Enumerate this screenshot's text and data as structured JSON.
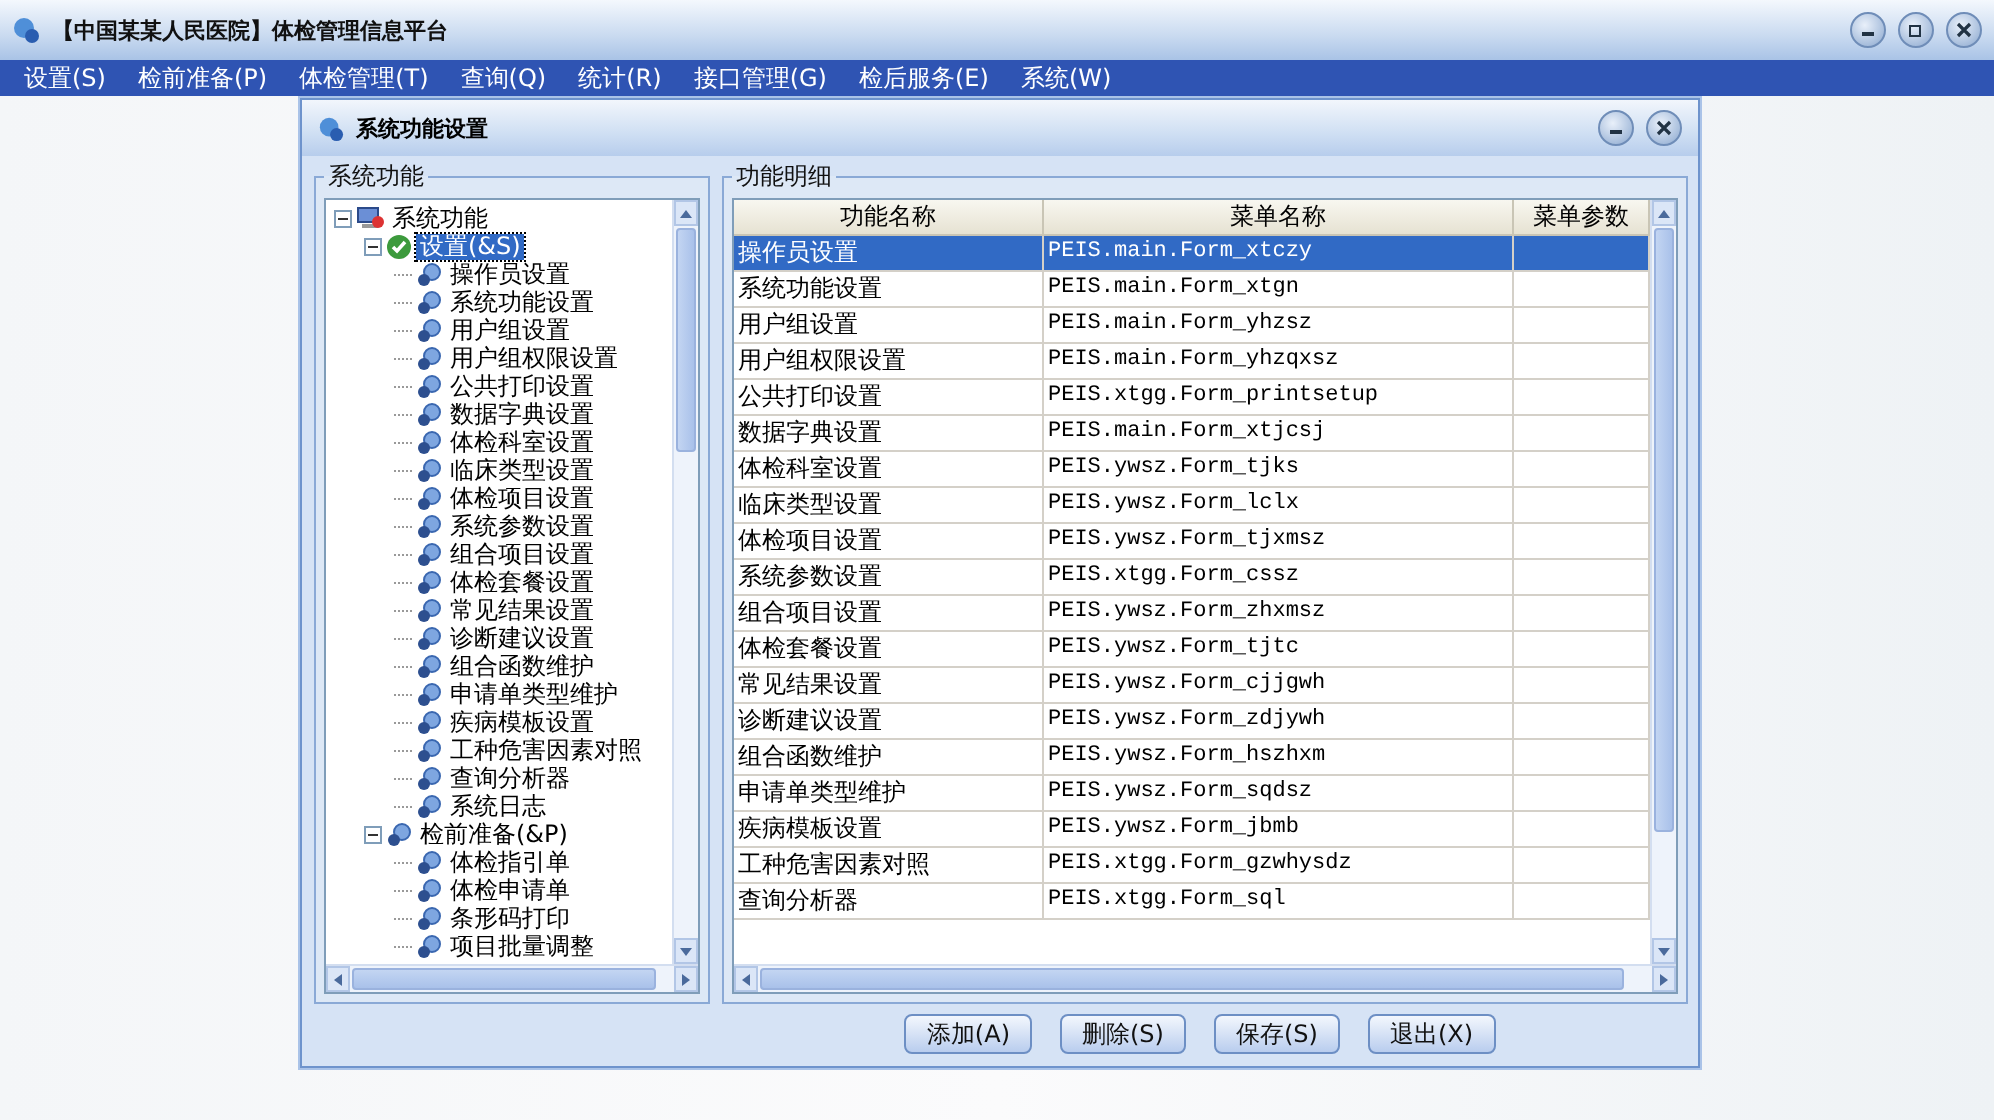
{
  "window": {
    "title": "【中国某某人民医院】体检管理信息平台"
  },
  "menu": [
    {
      "label": "设置(S)"
    },
    {
      "label": "检前准备(P)"
    },
    {
      "label": "体检管理(T)"
    },
    {
      "label": "查询(Q)"
    },
    {
      "label": "统计(R)"
    },
    {
      "label": "接口管理(G)"
    },
    {
      "label": "检后服务(E)"
    },
    {
      "label": "系统(W)"
    }
  ],
  "dialog": {
    "title": "系统功能设置",
    "tree_group": {
      "title": "系统功能",
      "tree": [
        {
          "label": "系统功能",
          "expanded": true,
          "selected": false,
          "children": [
            {
              "label": "设置(&S)",
              "expanded": true,
              "selected": true,
              "children": [
                {
                  "label": "操作员设置",
                  "selected": false
                },
                {
                  "label": "系统功能设置",
                  "selected": false
                },
                {
                  "label": "用户组设置",
                  "selected": false
                },
                {
                  "label": "用户组权限设置",
                  "selected": false
                },
                {
                  "label": "公共打印设置",
                  "selected": false
                },
                {
                  "label": "数据字典设置",
                  "selected": false
                },
                {
                  "label": "体检科室设置",
                  "selected": false
                },
                {
                  "label": "临床类型设置",
                  "selected": false
                },
                {
                  "label": "体检项目设置",
                  "selected": false
                },
                {
                  "label": "系统参数设置",
                  "selected": false
                },
                {
                  "label": "组合项目设置",
                  "selected": false
                },
                {
                  "label": "体检套餐设置",
                  "selected": false
                },
                {
                  "label": "常见结果设置",
                  "selected": false
                },
                {
                  "label": "诊断建议设置",
                  "selected": false
                },
                {
                  "label": "组合函数维护",
                  "selected": false
                },
                {
                  "label": "申请单类型维护",
                  "selected": false
                },
                {
                  "label": "疾病模板设置",
                  "selected": false
                },
                {
                  "label": "工种危害因素对照",
                  "selected": false
                },
                {
                  "label": "查询分析器",
                  "selected": false
                },
                {
                  "label": "系统日志",
                  "selected": false
                }
              ]
            },
            {
              "label": "检前准备(&P)",
              "expanded": true,
              "selected": false,
              "children": [
                {
                  "label": "体检指引单",
                  "selected": false
                },
                {
                  "label": "体检申请单",
                  "selected": false
                },
                {
                  "label": "条形码打印",
                  "selected": false
                },
                {
                  "label": "项目批量调整",
                  "selected": false
                }
              ]
            }
          ]
        }
      ]
    },
    "table_group": {
      "title": "功能明细",
      "columns": [
        "功能名称",
        "菜单名称",
        "菜单参数"
      ],
      "rows": [
        {
          "name": "操作员设置",
          "menu": "PEIS.main.Form_xtczy",
          "selected": true
        },
        {
          "name": "系统功能设置",
          "menu": "PEIS.main.Form_xtgn",
          "selected": false
        },
        {
          "name": "用户组设置",
          "menu": "PEIS.main.Form_yhzsz",
          "selected": false
        },
        {
          "name": "用户组权限设置",
          "menu": "PEIS.main.Form_yhzqxsz",
          "selected": false
        },
        {
          "name": "公共打印设置",
          "menu": "PEIS.xtgg.Form_printsetup",
          "selected": false
        },
        {
          "name": "数据字典设置",
          "menu": "PEIS.main.Form_xtjcsj",
          "selected": false
        },
        {
          "name": "体检科室设置",
          "menu": "PEIS.ywsz.Form_tjks",
          "selected": false
        },
        {
          "name": "临床类型设置",
          "menu": "PEIS.ywsz.Form_lclx",
          "selected": false
        },
        {
          "name": "体检项目设置",
          "menu": "PEIS.ywsz.Form_tjxmsz",
          "selected": false
        },
        {
          "name": "系统参数设置",
          "menu": "PEIS.xtgg.Form_cssz",
          "selected": false
        },
        {
          "name": "组合项目设置",
          "menu": "PEIS.ywsz.Form_zhxmsz",
          "selected": false
        },
        {
          "name": "体检套餐设置",
          "menu": "PEIS.ywsz.Form_tjtc",
          "selected": false
        },
        {
          "name": "常见结果设置",
          "menu": "PEIS.ywsz.Form_cjjgwh",
          "selected": false
        },
        {
          "name": "诊断建议设置",
          "menu": "PEIS.ywsz.Form_zdjywh",
          "selected": false
        },
        {
          "name": "组合函数维护",
          "menu": "PEIS.ywsz.Form_hszhxm",
          "selected": false
        },
        {
          "name": "申请单类型维护",
          "menu": "PEIS.ywsz.Form_sqdsz",
          "selected": false
        },
        {
          "name": "疾病模板设置",
          "menu": "PEIS.ywsz.Form_jbmb",
          "selected": false
        },
        {
          "name": "工种危害因素对照",
          "menu": "PEIS.xtgg.Form_gzwhysdz",
          "selected": false
        },
        {
          "name": "查询分析器",
          "menu": "PEIS.xtgg.Form_sql",
          "selected": false
        }
      ]
    },
    "buttons": [
      "添加(A)",
      "删除(S)",
      "保存(S)",
      "退出(X)"
    ]
  }
}
